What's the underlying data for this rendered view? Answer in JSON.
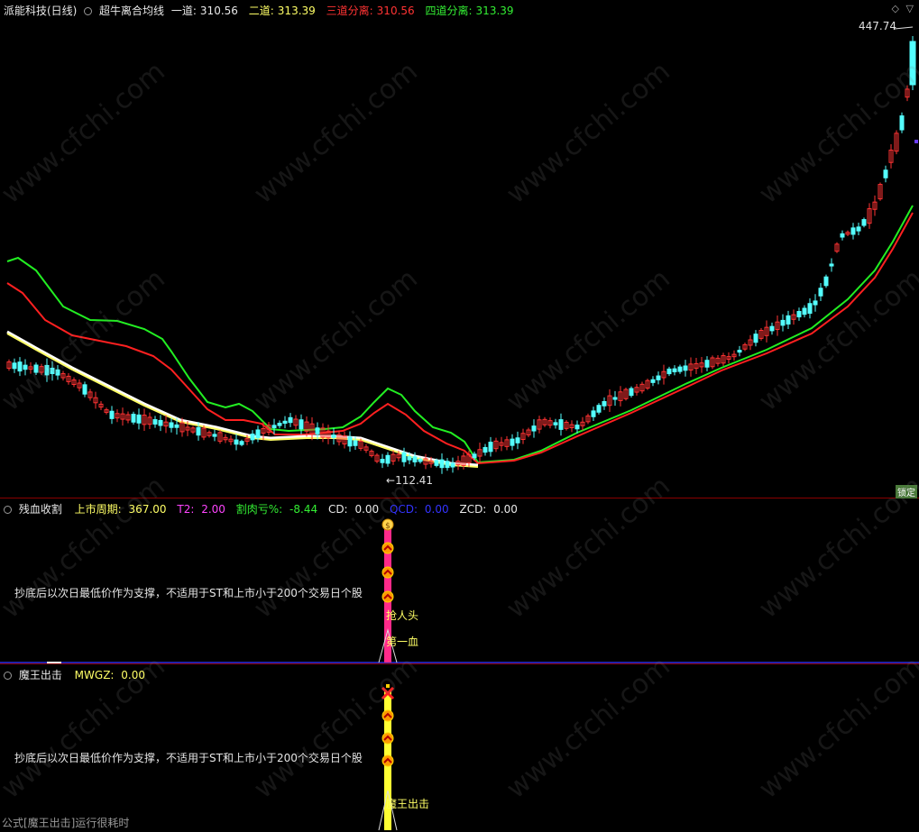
{
  "main": {
    "title": "派能科技(日线)",
    "indicator": "超牛离合均线",
    "lines": [
      {
        "label": "一道:",
        "value": "310.56",
        "color": "#e8e8e8"
      },
      {
        "label": "二道:",
        "value": "313.39",
        "color": "#ffff66"
      },
      {
        "label": "三道分离:",
        "value": "310.56",
        "color": "#ff3333"
      },
      {
        "label": "四道分离:",
        "value": "313.39",
        "color": "#33ee33"
      }
    ],
    "high_label": "447.74",
    "low_label": "112.41",
    "corner_tag": "锁定"
  },
  "sub1": {
    "name": "残血收割",
    "fields": [
      {
        "label": "上市周期:",
        "value": "367.00",
        "color": "#ffff66"
      },
      {
        "label": "T2:",
        "value": "2.00",
        "color": "#ff44ff"
      },
      {
        "label": "割肉亏%:",
        "value": "-8.44",
        "color": "#33ee33"
      },
      {
        "label": "CD:",
        "value": "0.00",
        "color": "#e8e8e8"
      },
      {
        "label": "QCD:",
        "value": "0.00",
        "color": "#3333ff"
      },
      {
        "label": "ZCD:",
        "value": "0.00",
        "color": "#e8e8e8"
      }
    ],
    "note": "抄底后以次日最低价作为支撑，不适用于ST和上市小于200个交易日个股",
    "label_a": "抢人头",
    "label_b": "第一血"
  },
  "sub2": {
    "name": "魔王出击",
    "fields": [
      {
        "label": "MWGZ:",
        "value": "0.00",
        "color": "#ffff66"
      }
    ],
    "note": "抄底后以次日最低价作为支撑，不适用于ST和上市小于200个交易日个股",
    "label_a": "魔王出击"
  },
  "footer": "公式[魔王出击]运行很耗时",
  "watermark": "www.cfchi.com",
  "colors": {
    "up": "#ff3333",
    "down": "#54ffff",
    "ma_white": "#ffffff",
    "ma_yellow": "#ffff66",
    "ma_red": "#ff2020",
    "ma_green": "#22ee22"
  }
}
